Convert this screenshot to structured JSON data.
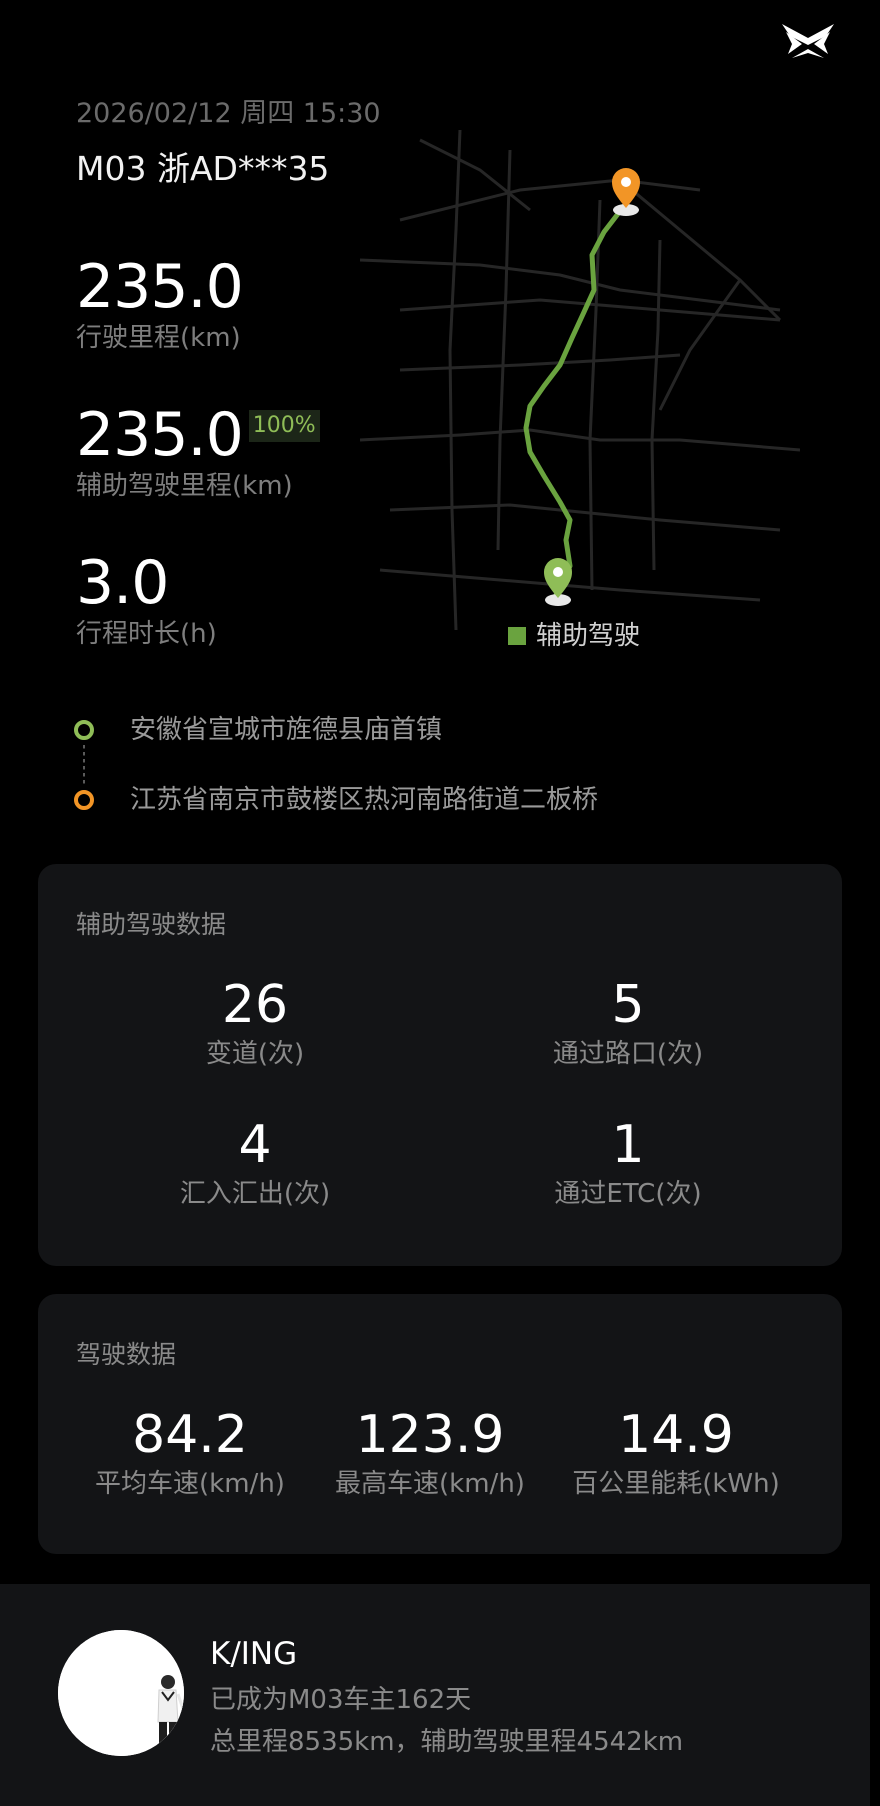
{
  "header": {
    "datetime": "2026/02/12 周四 15:30",
    "vehicle": "M03 浙AD***35",
    "logo_icon": "xpeng-logo"
  },
  "summary": {
    "distance_value": "235.0",
    "distance_label": "行驶里程(km)",
    "assisted_value": "235.0",
    "assisted_badge": "100%",
    "assisted_label": "辅助驾驶里程(km)",
    "duration_value": "3.0",
    "duration_label": "行程时长(h)"
  },
  "map": {
    "legend_label": "辅助驾驶",
    "route_color": "#6aa33f",
    "start_pin_color": "#8fbd57",
    "end_pin_color": "#f29526"
  },
  "route": {
    "start": "安徽省宣城市旌德县庙首镇",
    "end": "江苏省南京市鼓楼区热河南路街道二板桥"
  },
  "assist_card": {
    "title": "辅助驾驶数据",
    "items": [
      {
        "value": "26",
        "label": "变道(次)"
      },
      {
        "value": "5",
        "label": "通过路口(次)"
      },
      {
        "value": "4",
        "label": "汇入汇出(次)"
      },
      {
        "value": "1",
        "label": "通过ETC(次)"
      }
    ]
  },
  "drive_card": {
    "title": "驾驶数据",
    "items": [
      {
        "value": "84.2",
        "label": "平均车速(km/h)"
      },
      {
        "value": "123.9",
        "label": "最高车速(km/h)"
      },
      {
        "value": "14.9",
        "label": "百公里能耗(kWh)"
      }
    ]
  },
  "profile": {
    "name": "K/ING",
    "line1": "已成为M03车主162天",
    "line2": "总里程8535km，辅助驾驶里程4542km"
  }
}
